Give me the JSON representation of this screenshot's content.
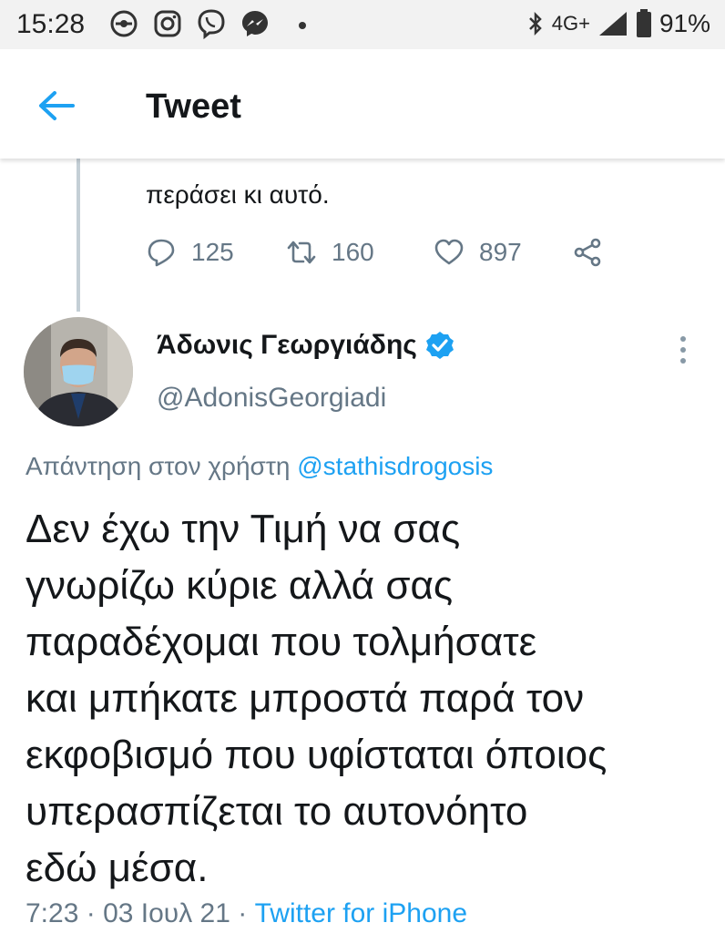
{
  "status_bar": {
    "time": "15:28",
    "network": "4G+",
    "battery": "91%",
    "notification_icons": [
      "sync-icon",
      "instagram-icon",
      "viber-icon",
      "messenger-icon",
      "dot-icon"
    ]
  },
  "header": {
    "title": "Tweet"
  },
  "previous_tweet": {
    "text_visible": "περάσει κι αυτό.",
    "replies": "125",
    "retweets": "160",
    "likes": "897"
  },
  "tweet": {
    "author_name": "Άδωνις Γεωργιάδης",
    "author_handle": "@AdonisGeorgiadi",
    "reply_prefix": "Απάντηση στον χρήστη",
    "reply_to": "@stathisdrogosis",
    "lines": [
      "Δεν έχω την Τιμή να σας",
      "γνωρίζω κύριε αλλά σας",
      "παραδέχομαι που τολμήσατε",
      "και μπήκατε μπροστά παρά τον",
      "εκφοβισμό που υφίσταται όποιος",
      "υπερασπίζεται το αυτονόητο",
      "εδώ μέσα."
    ],
    "time": "7:23",
    "date": "03 Ιουλ 21",
    "source": "Twitter for iPhone"
  },
  "colors": {
    "accent": "#1da1f2",
    "secondary_text": "#657786",
    "primary_text": "#14171a"
  }
}
